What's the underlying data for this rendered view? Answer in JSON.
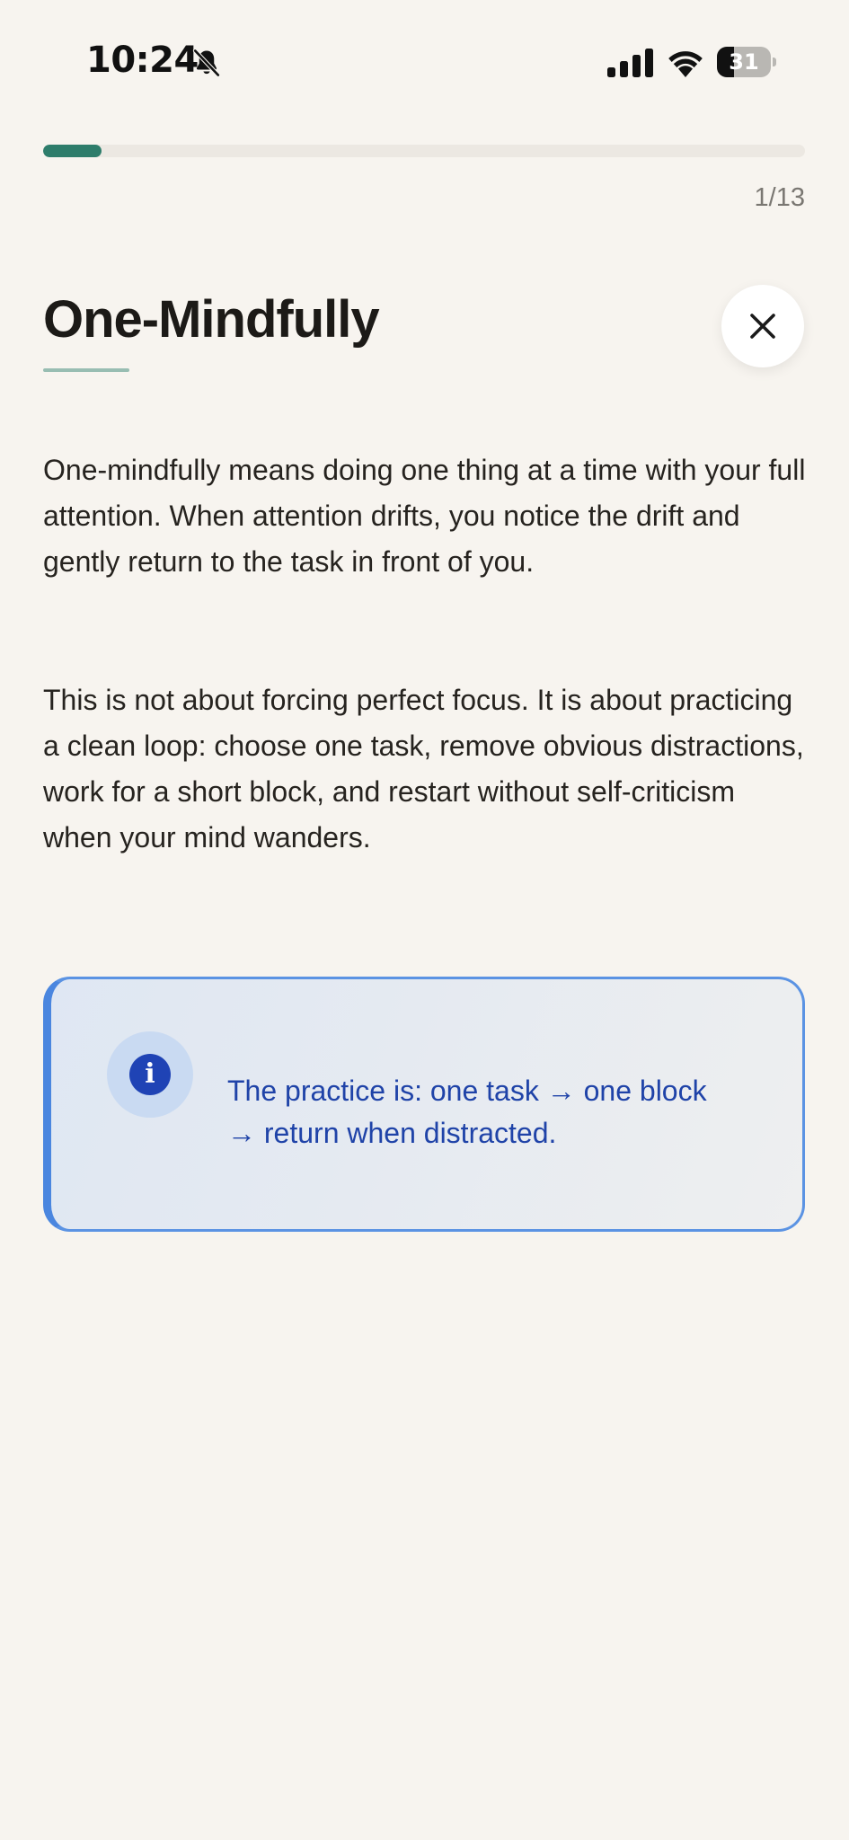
{
  "status_bar": {
    "time": "10:24",
    "battery_level": "31",
    "battery_fraction": 0.31,
    "icons": [
      "bell-slash-icon",
      "cellular-signal-icon",
      "wifi-icon",
      "battery-icon"
    ]
  },
  "progress": {
    "current": 1,
    "total": 13,
    "counter_label": "1/13",
    "fill_color": "#2e7d6b"
  },
  "header": {
    "title": "One-Mindfully",
    "close_icon": "close-icon"
  },
  "content": {
    "paragraphs": [
      "One-mindfully means doing one thing at a time with your full attention. When attention drifts, you notice the drift and gently return to the task in front of you.",
      "This is not about forcing perfect focus. It is about practicing a clean loop: choose one task, remove obvious distractions, work for a short block, and restart without self-criticism when your mind wanders."
    ]
  },
  "callout": {
    "icon": "info-icon",
    "glyph": "i",
    "text": "The practice is: one task → one block → return when distracted.",
    "accent_color": "#4a86df",
    "text_color": "#1f43a8"
  },
  "colors": {
    "background": "#f7f4ef",
    "accent": "#2e7d6b",
    "title_underline": "#98bdb2"
  }
}
